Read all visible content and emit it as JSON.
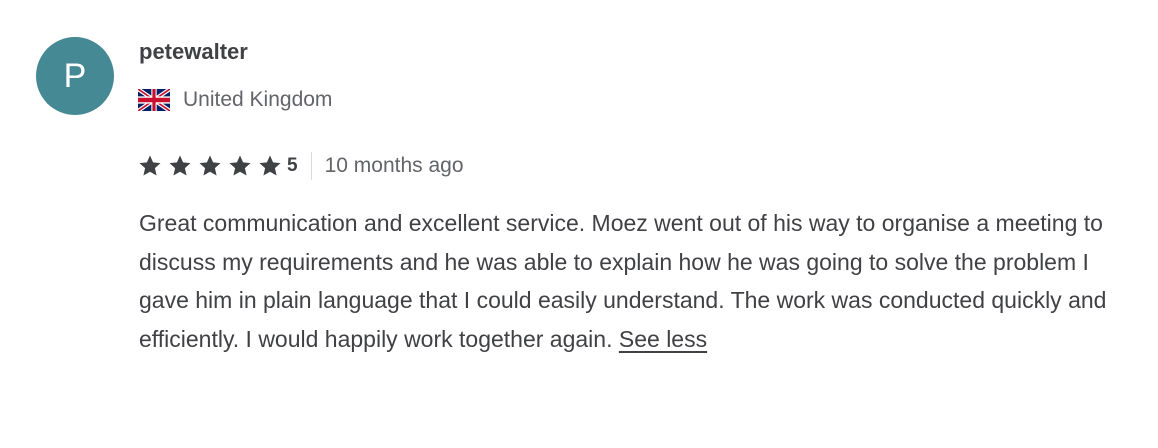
{
  "review": {
    "avatar_letter": "P",
    "avatar_color": "#458994",
    "username": "petewalter",
    "country": "United Kingdom",
    "country_flag_icon": "uk-flag-icon",
    "star_count": 5,
    "rating": "5",
    "time_ago": "10 months ago",
    "text": "Great communication and excellent service. Moez went out of his way to organise a meeting to discuss my requirements and he was able to explain how he was going to solve the problem I gave him in plain language that I could easily understand. The work was conducted quickly and efficiently. I would happily work together again.",
    "toggle_label": "See less"
  }
}
